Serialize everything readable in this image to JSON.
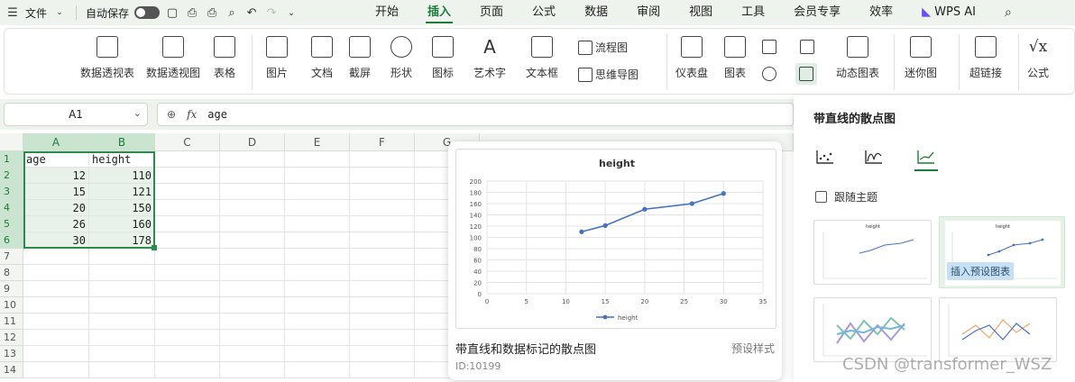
{
  "menubar": {
    "file_label": "文件",
    "autosave_label": "自动保存",
    "tabs": [
      "开始",
      "插入",
      "页面",
      "公式",
      "数据",
      "审阅",
      "视图",
      "工具",
      "会员专享",
      "效率"
    ],
    "wps_ai_label": "WPS AI"
  },
  "ribbon": {
    "pivot_table": "数据透视表",
    "pivot_chart": "数据透视图",
    "table": "表格",
    "picture": "图片",
    "doc": "文档",
    "screenshot": "截屏",
    "shape": "形状",
    "icon": "图标",
    "wordart": "艺术字",
    "textbox": "文本框",
    "flowchart": "流程图",
    "mindmap": "思维导图",
    "dashboard": "仪表盘",
    "chart": "图表",
    "dynamic_chart": "动态图表",
    "sparkline": "迷你图",
    "hyperlink": "超链接",
    "formula": "公式"
  },
  "formula_bar": {
    "cell_ref": "A1",
    "fx": "fx",
    "content": "age"
  },
  "sheet": {
    "columns": [
      "A",
      "B",
      "C",
      "D",
      "E",
      "F",
      "G"
    ],
    "rows": [
      "1",
      "2",
      "3",
      "4",
      "5",
      "6",
      "7",
      "8",
      "9",
      "10",
      "11",
      "12",
      "13",
      "14"
    ],
    "cells": [
      [
        "age",
        "height"
      ],
      [
        "12",
        "110"
      ],
      [
        "15",
        "121"
      ],
      [
        "20",
        "150"
      ],
      [
        "26",
        "160"
      ],
      [
        "30",
        "178"
      ]
    ]
  },
  "preview": {
    "title": "带直线和数据标记的散点图",
    "style_label": "预设样式",
    "id_label": "ID:10199"
  },
  "chart_data": {
    "type": "scatter",
    "title": "height",
    "x": [
      12,
      15,
      20,
      26,
      30
    ],
    "series": [
      {
        "name": "height",
        "values": [
          110,
          121,
          150,
          160,
          178
        ]
      }
    ],
    "xlim": [
      0,
      35
    ],
    "ylim": [
      0,
      200
    ],
    "xticks": [
      0,
      5,
      10,
      15,
      20,
      25,
      30,
      35
    ],
    "yticks": [
      0,
      20,
      40,
      60,
      80,
      100,
      120,
      140,
      160,
      180,
      200
    ],
    "grid": true,
    "legend": "bottom",
    "color": "#4472c4"
  },
  "panel": {
    "title": "带直线的散点图",
    "follow_theme": "跟随主题",
    "insert_preset": "插入预设图表"
  },
  "watermark": "CSDN @transformer_WSZ"
}
